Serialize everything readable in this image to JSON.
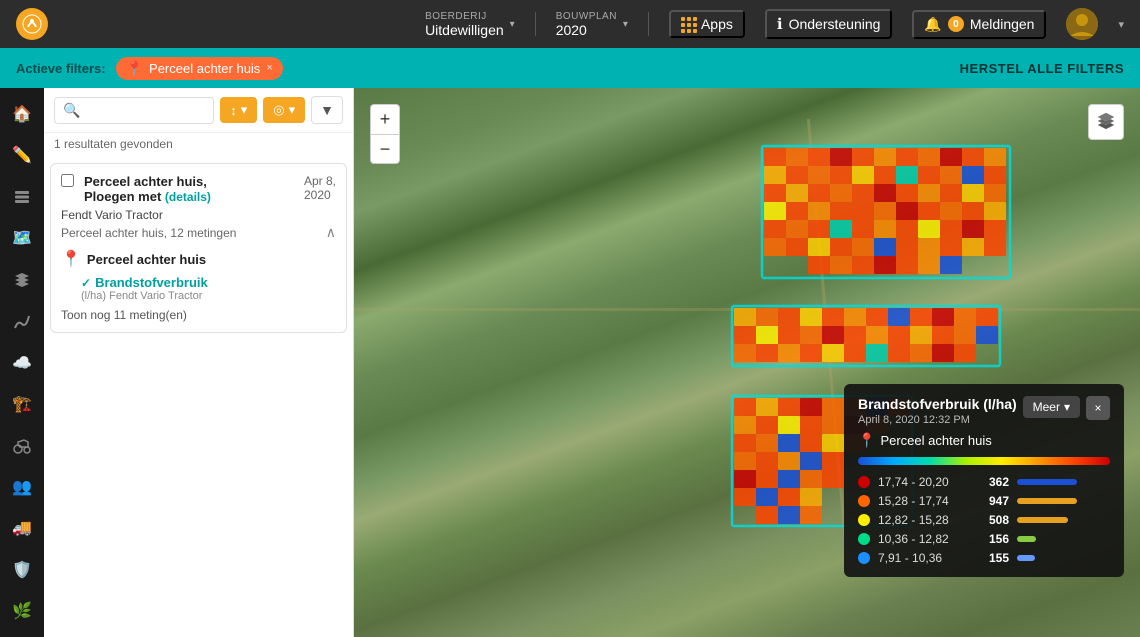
{
  "topnav": {
    "logo": "🌾",
    "farm_label": "BOERDERIJ",
    "farm_value": "Uitdewilligen",
    "plan_label": "BOUWPLAN",
    "plan_value": "2020",
    "apps_label": "Apps",
    "support_label": "Ondersteuning",
    "notifications_label": "Meldingen",
    "notifications_count": "0",
    "chevron": "▾"
  },
  "filterbar": {
    "active_filters_label": "Actieve filters:",
    "chip_text": "Perceel achter huis",
    "reset_label": "HERSTEL ALLE FILTERS"
  },
  "sidebar": {
    "icons": [
      {
        "name": "home-icon",
        "symbol": "⌂",
        "active": false
      },
      {
        "name": "edit-icon",
        "symbol": "✏",
        "active": false
      },
      {
        "name": "layers-icon",
        "symbol": "◫",
        "active": false
      },
      {
        "name": "map-icon",
        "symbol": "⊞",
        "active": false
      },
      {
        "name": "stack-icon",
        "symbol": "≡",
        "active": false
      },
      {
        "name": "chart-icon",
        "symbol": "↺",
        "active": false
      },
      {
        "name": "cloud-icon",
        "symbol": "☁",
        "active": false
      },
      {
        "name": "building-icon",
        "symbol": "⌂",
        "active": false
      },
      {
        "name": "tractor-icon",
        "symbol": "⚙",
        "active": false
      },
      {
        "name": "people-icon",
        "symbol": "👥",
        "active": false
      },
      {
        "name": "truck-icon",
        "symbol": "🚚",
        "active": false
      },
      {
        "name": "shield-icon",
        "symbol": "🛡",
        "active": false
      },
      {
        "name": "plant-icon",
        "symbol": "🌿",
        "active": false
      }
    ]
  },
  "panel": {
    "search_placeholder": "",
    "sort_btn1": "↕",
    "sort_btn2": "◎",
    "filter_btn": "▼",
    "results_count": "1 resultaten gevonden",
    "card": {
      "title": "Perceel achter huis,",
      "title2": "Ploegen met",
      "details_link": "(details)",
      "date_line1": "Apr 8,",
      "date_line2": "2020",
      "subtitle": "Fendt Vario Tractor",
      "meta": "Perceel achter huis, 12 metingen",
      "location_name": "Perceel achter huis",
      "measurement_label": "Brandstofverbruik",
      "measurement_unit": "(l/ha)",
      "measurement_device": "Fendt Vario Tractor",
      "show_more": "Toon nog 11 meting(en)"
    }
  },
  "map": {
    "zoom_in": "+",
    "zoom_out": "−",
    "layers_icon": "⧉"
  },
  "legend": {
    "title": "Brandstofverbruik (l/ha)",
    "date": "April 8, 2020 12:32 PM",
    "location": "Perceel achter huis",
    "more_btn": "Meer",
    "close_btn": "×",
    "rows": [
      {
        "range": "17,74 - 20,20",
        "count": "362",
        "color": "#cc0000",
        "bar_width": "100%",
        "bar_color": "#1a4fd6"
      },
      {
        "range": "15,28 - 17,74",
        "count": "947",
        "color": "#ff6600",
        "bar_width": "80%",
        "bar_color": "#e8a020"
      },
      {
        "range": "12,82 - 15,28",
        "count": "508",
        "color": "#ffee00",
        "bar_width": "55%",
        "bar_color": "#e8a020"
      },
      {
        "range": "10,36 - 12,82",
        "count": "156",
        "color": "#00dd88",
        "bar_width": "20%",
        "bar_color": "#88cc44"
      },
      {
        "range": "7,91 - 10,36",
        "count": "155",
        "color": "#1a8fff",
        "bar_width": "19%",
        "bar_color": "#6699ff"
      }
    ]
  }
}
